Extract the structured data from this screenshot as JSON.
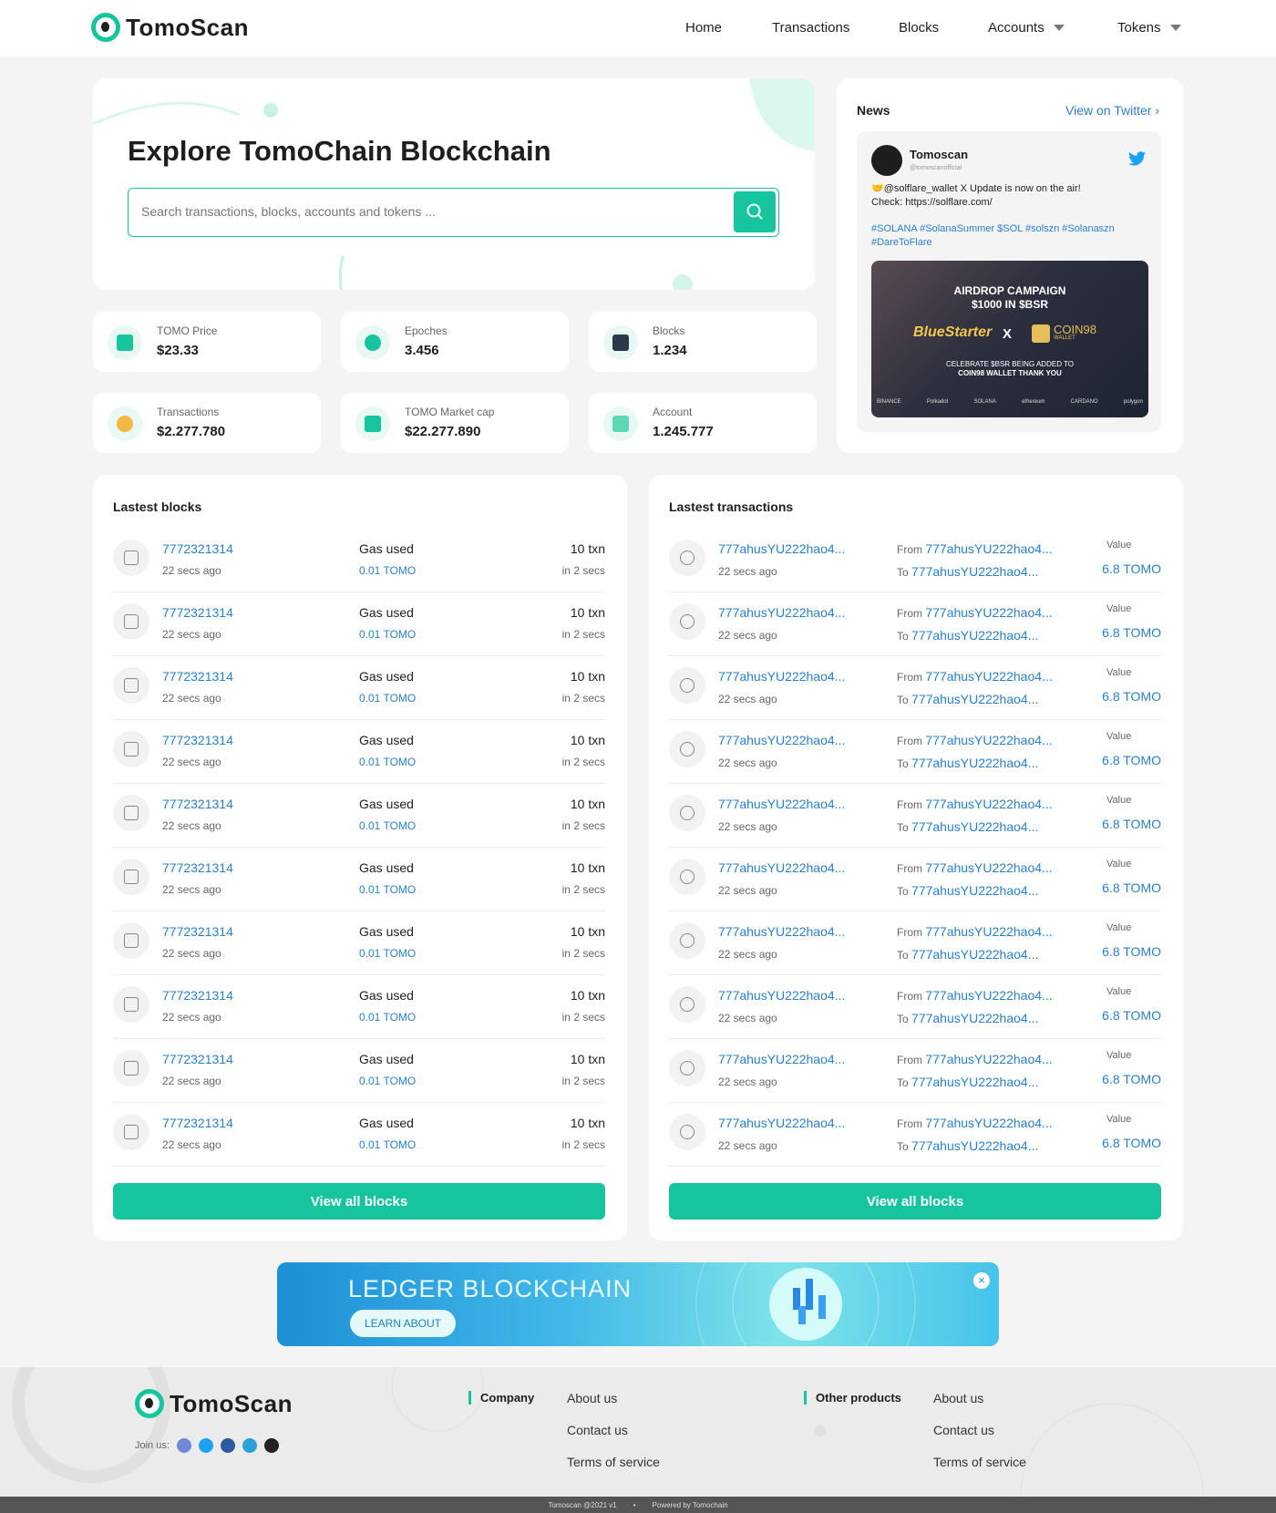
{
  "brand": {
    "logo_text": "TomoScan",
    "accent": "#16c59d",
    "link": "#2a7fcb"
  },
  "nav": {
    "home": "Home",
    "transactions": "Transactions",
    "blocks": "Blocks",
    "accounts": "Accounts",
    "tokens": "Tokens"
  },
  "hero": {
    "title": "Explore TomoChain Blockchain",
    "search_placeholder": "Search transactions, blocks, accounts and tokens ..."
  },
  "stats": [
    {
      "label": "TOMO Price",
      "value": "$23.33",
      "icon": "wallet-icon"
    },
    {
      "label": "Epoches",
      "value": "3.456",
      "icon": "clock-icon"
    },
    {
      "label": "Blocks",
      "value": "1.234",
      "icon": "blocks-icon"
    },
    {
      "label": "Transactions",
      "value": "$2.277.780",
      "icon": "coins-icon"
    },
    {
      "label": "TOMO Market cap",
      "value": "$22.277.890",
      "icon": "bar-chart-icon"
    },
    {
      "label": "Account",
      "value": "1.245.777",
      "icon": "account-icon"
    }
  ],
  "news": {
    "title": "News",
    "view_twitter": "View on Twitter",
    "tweet": {
      "author": "Tomoscan",
      "handle": "@tomoscanofficial",
      "text": "🤝@solflare_wallet X Update is now on the air!",
      "check": "Check: https://solflare.com/",
      "tags": "#SOLANA #SolanaSummer $SOL #solszn #Solanaszn #DareToFlare"
    },
    "image": {
      "line1": "AIRDROP CAMPAIGN",
      "line2": "$1000 IN $BSR",
      "brand1": "BlueStarter",
      "x": "X",
      "brand2": "COIN98",
      "brand2_sub": "WALLET",
      "caption1": "CELEBRATE $BSR BEING ADDED TO",
      "caption2": "COIN98 WALLET THANK YOU",
      "logos": [
        "BINANCE",
        "Polkadot",
        "SOLANA",
        "ethereum",
        "CARDANO",
        "polygon"
      ]
    }
  },
  "blocks": {
    "title": "Lastest blocks",
    "gas_label": "Gas used",
    "view_all": "View all blocks",
    "rows": [
      {
        "id": "7772321314",
        "age": "22 secs ago",
        "gas": "0.01 TOMO",
        "txn": "10 txn",
        "time": "in 2 secs"
      },
      {
        "id": "7772321314",
        "age": "22 secs ago",
        "gas": "0.01 TOMO",
        "txn": "10 txn",
        "time": "in 2 secs"
      },
      {
        "id": "7772321314",
        "age": "22 secs ago",
        "gas": "0.01 TOMO",
        "txn": "10 txn",
        "time": "in 2 secs"
      },
      {
        "id": "7772321314",
        "age": "22 secs ago",
        "gas": "0.01 TOMO",
        "txn": "10 txn",
        "time": "in 2 secs"
      },
      {
        "id": "7772321314",
        "age": "22 secs ago",
        "gas": "0.01 TOMO",
        "txn": "10 txn",
        "time": "in 2 secs"
      },
      {
        "id": "7772321314",
        "age": "22 secs ago",
        "gas": "0.01 TOMO",
        "txn": "10 txn",
        "time": "in 2 secs"
      },
      {
        "id": "7772321314",
        "age": "22 secs ago",
        "gas": "0.01 TOMO",
        "txn": "10 txn",
        "time": "in 2 secs"
      },
      {
        "id": "7772321314",
        "age": "22 secs ago",
        "gas": "0.01 TOMO",
        "txn": "10 txn",
        "time": "in 2 secs"
      },
      {
        "id": "7772321314",
        "age": "22 secs ago",
        "gas": "0.01 TOMO",
        "txn": "10 txn",
        "time": "in 2 secs"
      },
      {
        "id": "7772321314",
        "age": "22 secs ago",
        "gas": "0.01 TOMO",
        "txn": "10 txn",
        "time": "in 2 secs"
      }
    ]
  },
  "transactions": {
    "title": "Lastest transactions",
    "from_label": "From",
    "to_label": "To",
    "value_label": "Value",
    "view_all": "View all blocks",
    "rows": [
      {
        "hash": "777ahusYU222hao4...",
        "age": "22 secs ago",
        "from": "777ahusYU222hao4...",
        "to": "777ahusYU222hao4...",
        "value": "6.8 TOMO"
      },
      {
        "hash": "777ahusYU222hao4...",
        "age": "22 secs ago",
        "from": "777ahusYU222hao4...",
        "to": "777ahusYU222hao4...",
        "value": "6.8 TOMO"
      },
      {
        "hash": "777ahusYU222hao4...",
        "age": "22 secs ago",
        "from": "777ahusYU222hao4...",
        "to": "777ahusYU222hao4...",
        "value": "6.8 TOMO"
      },
      {
        "hash": "777ahusYU222hao4...",
        "age": "22 secs ago",
        "from": "777ahusYU222hao4...",
        "to": "777ahusYU222hao4...",
        "value": "6.8 TOMO"
      },
      {
        "hash": "777ahusYU222hao4...",
        "age": "22 secs ago",
        "from": "777ahusYU222hao4...",
        "to": "777ahusYU222hao4...",
        "value": "6.8 TOMO"
      },
      {
        "hash": "777ahusYU222hao4...",
        "age": "22 secs ago",
        "from": "777ahusYU222hao4...",
        "to": "777ahusYU222hao4...",
        "value": "6.8 TOMO"
      },
      {
        "hash": "777ahusYU222hao4...",
        "age": "22 secs ago",
        "from": "777ahusYU222hao4...",
        "to": "777ahusYU222hao4...",
        "value": "6.8 TOMO"
      },
      {
        "hash": "777ahusYU222hao4...",
        "age": "22 secs ago",
        "from": "777ahusYU222hao4...",
        "to": "777ahusYU222hao4...",
        "value": "6.8 TOMO"
      },
      {
        "hash": "777ahusYU222hao4...",
        "age": "22 secs ago",
        "from": "777ahusYU222hao4...",
        "to": "777ahusYU222hao4...",
        "value": "6.8 TOMO"
      },
      {
        "hash": "777ahusYU222hao4...",
        "age": "22 secs ago",
        "from": "777ahusYU222hao4...",
        "to": "777ahusYU222hao4...",
        "value": "6.8 TOMO"
      }
    ]
  },
  "banner": {
    "title": "LEDGER BLOCKCHAIN",
    "button": "LEARN ABOUT"
  },
  "footer": {
    "join": "Join us:",
    "company_title": "Company",
    "company_links": [
      "About us",
      "Contact us",
      "Terms of service"
    ],
    "other_title": "Other products",
    "other_links": [
      "About us",
      "Contact us",
      "Terms of service"
    ],
    "copyright": "Tomoscan @2021 v1",
    "powered": "Powered by Tomochain"
  }
}
